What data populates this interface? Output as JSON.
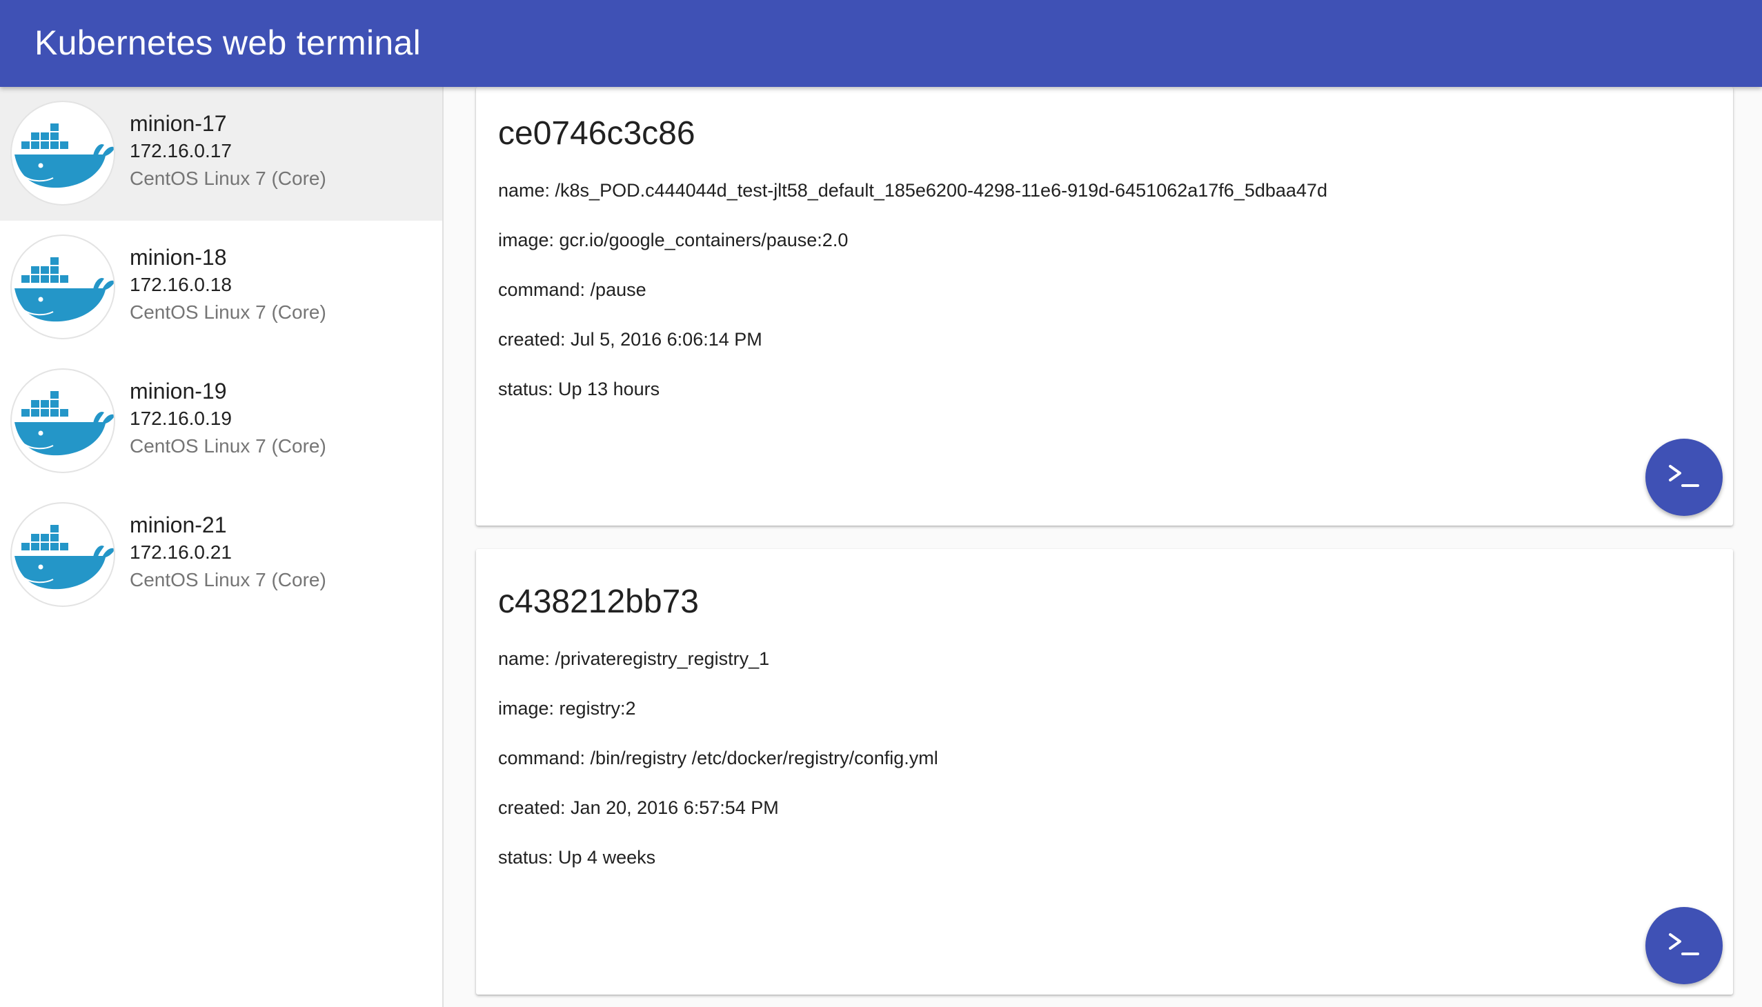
{
  "app_bar": {
    "title": "Kubernetes web terminal"
  },
  "sidebar": {
    "nodes": [
      {
        "name": "minion-17",
        "ip": "172.16.0.17",
        "os": "CentOS Linux 7 (Core)",
        "icon": "docker-whale-icon",
        "selected": true
      },
      {
        "name": "minion-18",
        "ip": "172.16.0.18",
        "os": "CentOS Linux 7 (Core)",
        "icon": "docker-whale-icon",
        "selected": false
      },
      {
        "name": "minion-19",
        "ip": "172.16.0.19",
        "os": "CentOS Linux 7 (Core)",
        "icon": "docker-whale-icon",
        "selected": false
      },
      {
        "name": "minion-21",
        "ip": "172.16.0.21",
        "os": "CentOS Linux 7 (Core)",
        "icon": "docker-whale-icon",
        "selected": false
      }
    ]
  },
  "containers": [
    {
      "id": "ce0746c3c86",
      "name": "name: /k8s_POD.c444044d_test-jlt58_default_185e6200-4298-11e6-919d-6451062a17f6_5dbaa47d",
      "image": "image: gcr.io/google_containers/pause:2.0",
      "command": "command: /pause",
      "created": "created: Jul 5, 2016 6:06:14 PM",
      "status": "status: Up 13 hours",
      "action_icon": "terminal-icon"
    },
    {
      "id": "c438212bb73",
      "name": "name: /privateregistry_registry_1",
      "image": "image: registry:2",
      "command": "command: /bin/registry /etc/docker/registry/config.yml",
      "created": "created: Jan 20, 2016 6:57:54 PM",
      "status": "status: Up 4 weeks",
      "action_icon": "terminal-icon"
    }
  ],
  "colors": {
    "primary": "#3f51b5",
    "docker_blue": "#2496c8",
    "selected_background": "#efefef"
  }
}
